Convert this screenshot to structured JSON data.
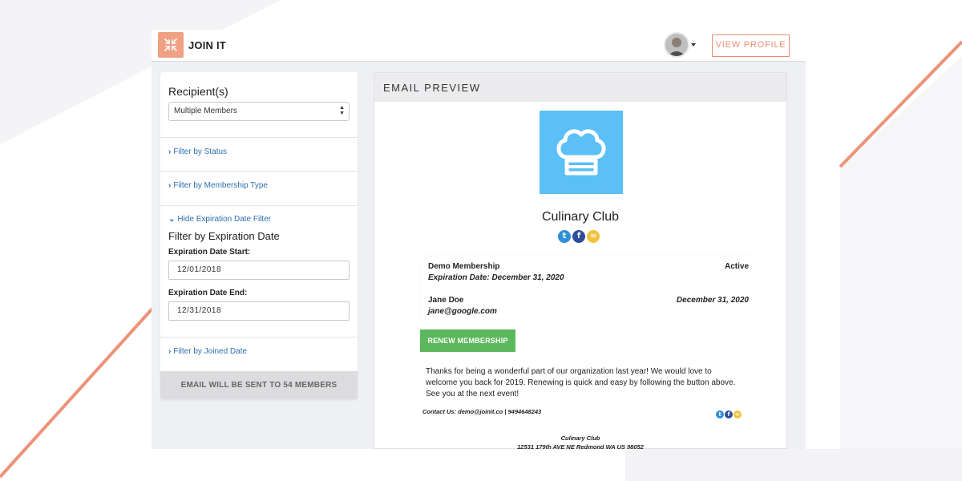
{
  "app": {
    "brand": "JOIN IT",
    "view_profile_label": "VIEW PROFILE"
  },
  "colors": {
    "accent": "#ee8d74",
    "logo_bg": "#f0a083",
    "link": "#2d6fb3",
    "club_logo_bg": "#5bc0f5",
    "renew_green": "#5cb85c"
  },
  "filters": {
    "recipients_label": "Recipient(s)",
    "recipients_value": "Multiple Members",
    "status_link": "Filter by Status",
    "membership_type_link": "Filter by Membership Type",
    "hide_expiration_link": "Hide Expiration Date Filter",
    "expiration_title": "Filter by Expiration Date",
    "start_label": "Expiration Date Start:",
    "start_value": "12/01/2018",
    "end_label": "Expiration Date End:",
    "end_value": "12/31/2018",
    "joined_date_link": "Filter by Joined Date",
    "send_summary": "EMAIL WILL BE SENT TO 54 MEMBERS"
  },
  "preview": {
    "header": "EMAIL PREVIEW",
    "club_name": "Culinary Club",
    "membership_name": "Demo Membership",
    "membership_status": "Active",
    "expiration_line": "Expiration Date: December 31, 2020",
    "member_name": "Jane Doe",
    "member_date": "December 31, 2020",
    "member_email": "jane@google.com",
    "renew_label": "RENEW MEMBERSHIP",
    "message": "Thanks for being a wonderful part of our organization last year! We would love to welcome you back for 2019. Renewing is quick and easy by following the button above. See you at the next event!",
    "contact": "Contact Us: demo@joinit.co | 9494648243",
    "footer_name": "Culinary Club",
    "footer_address": "12531 179th AVE NE Redmond WA US 98052"
  },
  "icons": {
    "social": [
      "twitter-icon",
      "facebook-icon",
      "link-icon"
    ],
    "logo": "compress-arrows-icon",
    "club": "chef-hat-icon"
  }
}
